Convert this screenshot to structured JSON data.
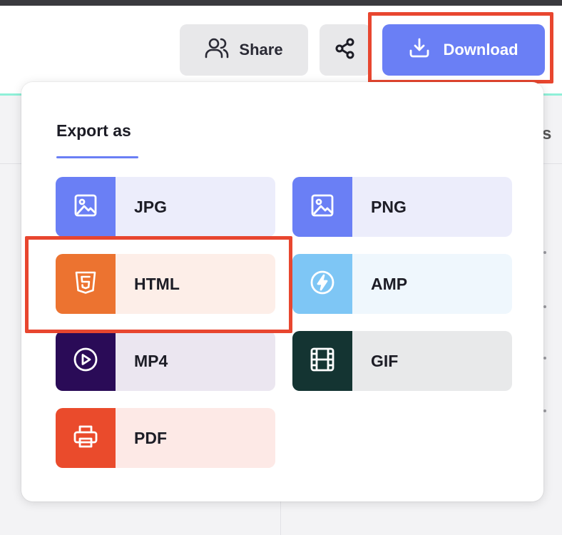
{
  "toolbar": {
    "share_label": "Share",
    "share_icon": "users-icon",
    "share_network_icon": "share-nodes-icon",
    "download_label": "Download",
    "download_icon": "download-icon"
  },
  "export_menu": {
    "title": "Export as",
    "options": [
      {
        "label": "JPG",
        "icon": "image-icon",
        "icon_bg": "#6a7ff5",
        "label_bg": "#ecedfb"
      },
      {
        "label": "PNG",
        "icon": "image-icon",
        "icon_bg": "#6a7ff5",
        "label_bg": "#ecedfb"
      },
      {
        "label": "HTML",
        "icon": "html5-icon",
        "icon_bg": "#ec7330",
        "label_bg": "#fdeee8"
      },
      {
        "label": "AMP",
        "icon": "amp-bolt-icon",
        "icon_bg": "#7ec6f5",
        "label_bg": "#eff7fd"
      },
      {
        "label": "MP4",
        "icon": "play-circle-icon",
        "icon_bg": "#2a0b57",
        "label_bg": "#ebe6f0"
      },
      {
        "label": "GIF",
        "icon": "film-icon",
        "icon_bg": "#143432",
        "label_bg": "#e8e9ea"
      },
      {
        "label": "PDF",
        "icon": "printer-icon",
        "icon_bg": "#ea4b2c",
        "label_bg": "#fde9e6"
      }
    ]
  },
  "colors": {
    "accent": "#6a7ff5",
    "highlight": "#e8462f"
  }
}
